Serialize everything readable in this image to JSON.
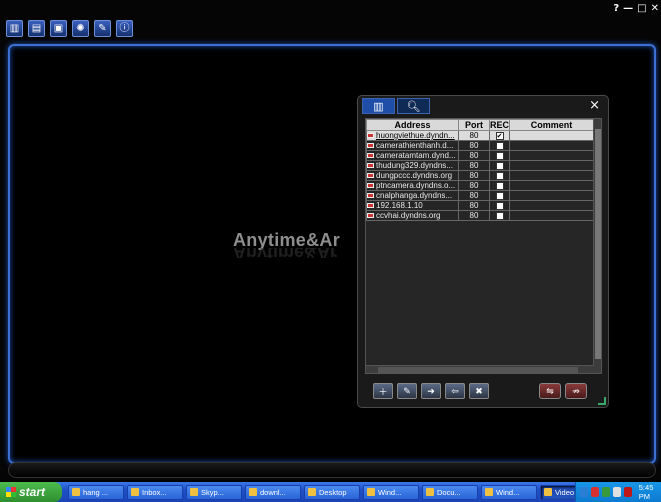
{
  "app": {
    "toolbar_icons": [
      "layout-icon",
      "document-icon",
      "camera-list-icon",
      "settings-icon",
      "tools-icon",
      "info-icon"
    ],
    "window_controls": [
      "?",
      "—",
      "□",
      "✕"
    ],
    "logo_text": "Anytime&Ar"
  },
  "panel": {
    "tabs": [
      "split-view-icon",
      "search-icon"
    ],
    "close": "×",
    "columns": {
      "address": "Address",
      "port": "Port",
      "rec": "REC",
      "comment": "Comment"
    },
    "rows": [
      {
        "address": "huongviethue.dyndn...",
        "port": "80",
        "rec": "✔",
        "selected": true
      },
      {
        "address": "camerathienthanh.d...",
        "port": "80",
        "rec": "",
        "selected": false
      },
      {
        "address": "cameratamtam.dynd...",
        "port": "80",
        "rec": "",
        "selected": false
      },
      {
        "address": "thudung329.dyndns...",
        "port": "80",
        "rec": "",
        "selected": false
      },
      {
        "address": "dungpccc.dyndns.org",
        "port": "80",
        "rec": "",
        "selected": false
      },
      {
        "address": "ptncamera.dyndns.o...",
        "port": "80",
        "rec": "",
        "selected": false
      },
      {
        "address": "cnalphanga.dyndns...",
        "port": "80",
        "rec": "",
        "selected": false
      },
      {
        "address": "192.168.1.10",
        "port": "80",
        "rec": "",
        "selected": false
      },
      {
        "address": "ccvhai.dyndns.org",
        "port": "80",
        "rec": "",
        "selected": false
      }
    ],
    "action_buttons": [
      "add-icon",
      "edit-icon",
      "export-icon",
      "import-icon",
      "delete-icon"
    ],
    "right_buttons": [
      "connect-icon",
      "disconnect-icon"
    ]
  },
  "taskbar": {
    "start_label": "start",
    "tasks": [
      {
        "label": "hang ...",
        "active": false
      },
      {
        "label": "Inbox...",
        "active": false
      },
      {
        "label": "Skyp...",
        "active": false
      },
      {
        "label": "downl...",
        "active": false
      },
      {
        "label": "Desktop",
        "active": false
      },
      {
        "label": "Wind...",
        "active": false
      },
      {
        "label": "Docu...",
        "active": false
      },
      {
        "label": "Wind...",
        "active": false
      },
      {
        "label": "Video ...",
        "active": true
      }
    ],
    "clock": "5:45 PM",
    "tray_colors": [
      "#2a7fd4",
      "#d83030",
      "#3a9a3a",
      "#e0e0e0",
      "#c01818"
    ]
  }
}
